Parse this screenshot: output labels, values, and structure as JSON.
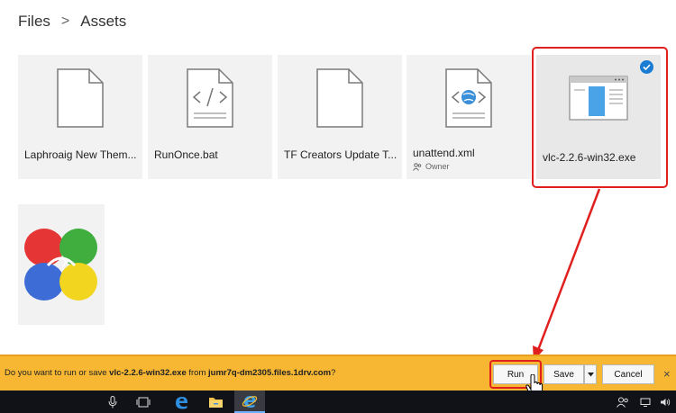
{
  "breadcrumb": {
    "root": "Files",
    "separator": ">",
    "current": "Assets"
  },
  "files": [
    {
      "name": "Laphroaig New Them...",
      "icon": "document-icon"
    },
    {
      "name": "RunOnce.bat",
      "icon": "code-file-icon"
    },
    {
      "name": "TF Creators Update T...",
      "icon": "document-icon"
    },
    {
      "name": "unattend.xml",
      "icon": "web-file-icon",
      "owner": "Owner"
    },
    {
      "name": "vlc-2.2.6-win32.exe",
      "icon": "window-app-icon",
      "selected": true
    }
  ],
  "notification": {
    "prefix": "Do you want to run or save ",
    "filename": "vlc-2.2.6-win32.exe",
    "middle": " from ",
    "source": "jumr7q-dm2305.files.1drv.com",
    "suffix": "?",
    "run_label": "Run",
    "save_label": "Save",
    "cancel_label": "Cancel",
    "close_label": "×"
  },
  "colors": {
    "notification_bar": "#f7b733",
    "highlight": "#e0201f",
    "check": "#1a7bd3",
    "taskbar": "#111218"
  },
  "taskbar": {
    "icons": [
      "microphone-icon",
      "task-view-icon",
      "edge-icon",
      "file-explorer-icon",
      "internet-explorer-icon",
      "people-icon",
      "network-icon",
      "volume-icon"
    ]
  }
}
